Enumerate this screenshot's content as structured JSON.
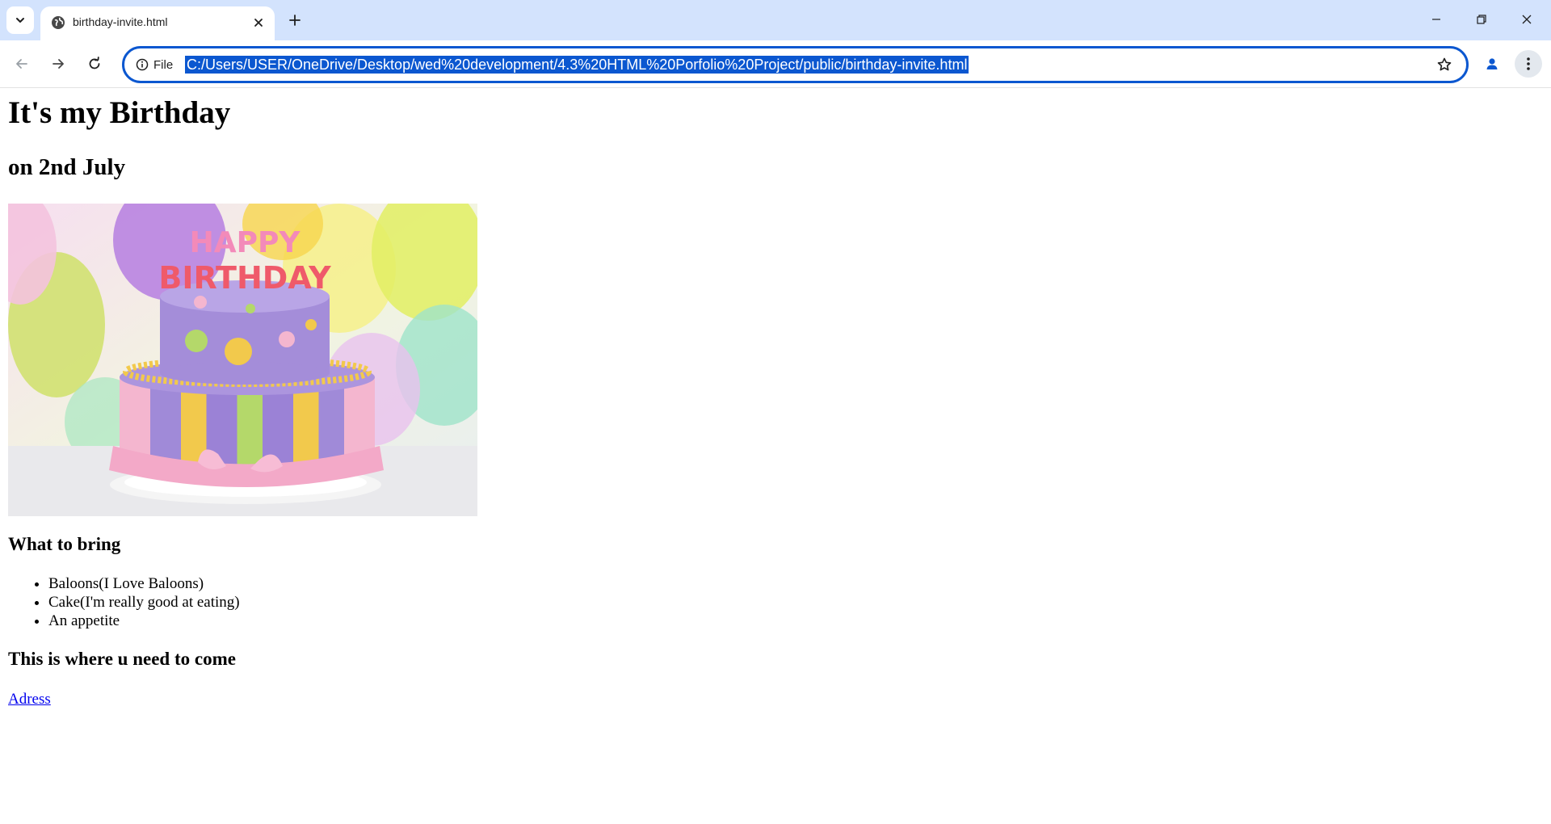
{
  "browser": {
    "tab_title": "birthday-invite.html",
    "site_info_label": "File",
    "url": "C:/Users/USER/OneDrive/Desktop/wed%20development/4.3%20HTML%20Porfolio%20Project/public/birthday-invite.html",
    "accent_color": "#0b57d0",
    "tabstrip_color": "#d3e3fd"
  },
  "page": {
    "heading": "It's my Birthday",
    "subheading": "on 2nd July",
    "image_text": "HAPPY BIRTHDAY",
    "bring_heading": "What to bring",
    "bring_items": [
      "Baloons(I Love Baloons)",
      "Cake(I'm really good at eating)",
      "An appetite"
    ],
    "location_heading": "This is where u need to come",
    "address_link": "Adress",
    "link_color": "#0000ee"
  }
}
